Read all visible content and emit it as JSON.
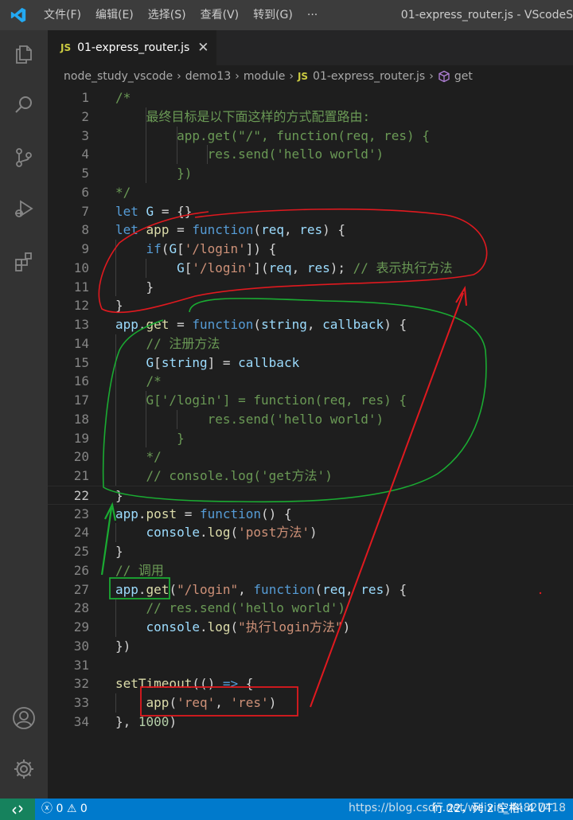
{
  "titlebar": {
    "menu": [
      "文件(F)",
      "编辑(E)",
      "选择(S)",
      "查看(V)",
      "转到(G)",
      "···"
    ],
    "window_title": "01-express_router.js - VScodeS"
  },
  "tab": {
    "js_badge": "JS",
    "label": "01-express_router.js",
    "close": "✕"
  },
  "breadcrumb": {
    "items": [
      "node_study_vscode",
      "demo13",
      "module",
      "01-express_router.js",
      "get"
    ],
    "js_badge": "JS"
  },
  "editor": {
    "current_line": 22,
    "lines": [
      {
        "n": "1",
        "tokens": [
          [
            "cmt",
            "/*"
          ]
        ]
      },
      {
        "n": "2",
        "tokens": [
          [
            "cmt",
            "    最终目标是以下面这样的方式配置路由:"
          ]
        ]
      },
      {
        "n": "3",
        "tokens": [
          [
            "cmt",
            "        app.get(\"/\", function(req, res) {"
          ]
        ]
      },
      {
        "n": "4",
        "tokens": [
          [
            "cmt",
            "            res.send('hello world')"
          ]
        ]
      },
      {
        "n": "5",
        "tokens": [
          [
            "cmt",
            "        })"
          ]
        ]
      },
      {
        "n": "6",
        "tokens": [
          [
            "cmt",
            "*/"
          ]
        ]
      },
      {
        "n": "7",
        "tokens": [
          [
            "kw",
            "let"
          ],
          [
            "pn",
            " "
          ],
          [
            "var",
            "G"
          ],
          [
            "pn",
            " = {}"
          ]
        ]
      },
      {
        "n": "8",
        "tokens": [
          [
            "kw",
            "let"
          ],
          [
            "pn",
            " "
          ],
          [
            "fn",
            "app"
          ],
          [
            "pn",
            " = "
          ],
          [
            "kw",
            "function"
          ],
          [
            "pn",
            "("
          ],
          [
            "var",
            "req"
          ],
          [
            "pn",
            ", "
          ],
          [
            "var",
            "res"
          ],
          [
            "pn",
            ") {"
          ]
        ]
      },
      {
        "n": "9",
        "tokens": [
          [
            "pn",
            "    "
          ],
          [
            "kw",
            "if"
          ],
          [
            "pn",
            "("
          ],
          [
            "var",
            "G"
          ],
          [
            "pn",
            "["
          ],
          [
            "str",
            "'/login'"
          ],
          [
            "pn",
            "]) {"
          ]
        ]
      },
      {
        "n": "10",
        "tokens": [
          [
            "pn",
            "        "
          ],
          [
            "var",
            "G"
          ],
          [
            "pn",
            "["
          ],
          [
            "str",
            "'/login'"
          ],
          [
            "pn",
            "]("
          ],
          [
            "var",
            "req"
          ],
          [
            "pn",
            ", "
          ],
          [
            "var",
            "res"
          ],
          [
            "pn",
            "); "
          ],
          [
            "cmt",
            "// 表示执行方法"
          ]
        ]
      },
      {
        "n": "11",
        "tokens": [
          [
            "pn",
            "    }"
          ]
        ]
      },
      {
        "n": "12",
        "tokens": [
          [
            "pn",
            "}"
          ]
        ]
      },
      {
        "n": "13",
        "tokens": [
          [
            "var",
            "app"
          ],
          [
            "pn",
            "."
          ],
          [
            "fn",
            "get"
          ],
          [
            "pn",
            " = "
          ],
          [
            "kw",
            "function"
          ],
          [
            "pn",
            "("
          ],
          [
            "var",
            "string"
          ],
          [
            "pn",
            ", "
          ],
          [
            "var",
            "callback"
          ],
          [
            "pn",
            ") {"
          ]
        ]
      },
      {
        "n": "14",
        "tokens": [
          [
            "pn",
            "    "
          ],
          [
            "cmt",
            "// 注册方法"
          ]
        ]
      },
      {
        "n": "15",
        "tokens": [
          [
            "pn",
            "    "
          ],
          [
            "var",
            "G"
          ],
          [
            "pn",
            "["
          ],
          [
            "var",
            "string"
          ],
          [
            "pn",
            "] = "
          ],
          [
            "var",
            "callback"
          ]
        ]
      },
      {
        "n": "16",
        "tokens": [
          [
            "pn",
            "    "
          ],
          [
            "cmt",
            "/*"
          ]
        ]
      },
      {
        "n": "17",
        "tokens": [
          [
            "pn",
            "    "
          ],
          [
            "cmt",
            "G['/login'] = function(req, res) {"
          ]
        ]
      },
      {
        "n": "18",
        "tokens": [
          [
            "pn",
            "    "
          ],
          [
            "cmt",
            "        res.send('hello world')"
          ]
        ]
      },
      {
        "n": "19",
        "tokens": [
          [
            "pn",
            "    "
          ],
          [
            "cmt",
            "    }"
          ]
        ]
      },
      {
        "n": "20",
        "tokens": [
          [
            "pn",
            "    "
          ],
          [
            "cmt",
            "*/"
          ]
        ]
      },
      {
        "n": "21",
        "tokens": [
          [
            "pn",
            "    "
          ],
          [
            "cmt",
            "// console.log('get方法')"
          ]
        ]
      },
      {
        "n": "22",
        "tokens": [
          [
            "pn",
            "}"
          ]
        ]
      },
      {
        "n": "23",
        "tokens": [
          [
            "var",
            "app"
          ],
          [
            "pn",
            "."
          ],
          [
            "fn",
            "post"
          ],
          [
            "pn",
            " = "
          ],
          [
            "kw",
            "function"
          ],
          [
            "pn",
            "() {"
          ]
        ]
      },
      {
        "n": "24",
        "tokens": [
          [
            "pn",
            "    "
          ],
          [
            "var",
            "console"
          ],
          [
            "pn",
            "."
          ],
          [
            "fn",
            "log"
          ],
          [
            "pn",
            "("
          ],
          [
            "str",
            "'post方法'"
          ],
          [
            "pn",
            ")"
          ]
        ]
      },
      {
        "n": "25",
        "tokens": [
          [
            "pn",
            "}"
          ]
        ]
      },
      {
        "n": "26",
        "tokens": [
          [
            "cmt",
            "// 调用"
          ]
        ]
      },
      {
        "n": "27",
        "tokens": [
          [
            "var",
            "app"
          ],
          [
            "pn",
            "."
          ],
          [
            "fn",
            "get"
          ],
          [
            "pn",
            "("
          ],
          [
            "str",
            "\"/login\""
          ],
          [
            "pn",
            ", "
          ],
          [
            "kw",
            "function"
          ],
          [
            "pn",
            "("
          ],
          [
            "var",
            "req"
          ],
          [
            "pn",
            ", "
          ],
          [
            "var",
            "res"
          ],
          [
            "pn",
            ") {"
          ]
        ]
      },
      {
        "n": "28",
        "tokens": [
          [
            "pn",
            "    "
          ],
          [
            "cmt",
            "// res.send('hello world')"
          ]
        ]
      },
      {
        "n": "29",
        "tokens": [
          [
            "pn",
            "    "
          ],
          [
            "var",
            "console"
          ],
          [
            "pn",
            "."
          ],
          [
            "fn",
            "log"
          ],
          [
            "pn",
            "("
          ],
          [
            "str",
            "\"执行login方法\""
          ],
          [
            "pn",
            ")"
          ]
        ]
      },
      {
        "n": "30",
        "tokens": [
          [
            "pn",
            "})"
          ]
        ]
      },
      {
        "n": "31",
        "tokens": []
      },
      {
        "n": "32",
        "tokens": [
          [
            "fn",
            "setTimeout"
          ],
          [
            "pn",
            "(() "
          ],
          [
            "kw",
            "=>"
          ],
          [
            "pn",
            " {"
          ]
        ]
      },
      {
        "n": "33",
        "tokens": [
          [
            "pn",
            "    "
          ],
          [
            "fn",
            "app"
          ],
          [
            "pn",
            "("
          ],
          [
            "str",
            "'req'"
          ],
          [
            "pn",
            ", "
          ],
          [
            "str",
            "'res'"
          ],
          [
            "pn",
            ")"
          ]
        ]
      },
      {
        "n": "34",
        "tokens": [
          [
            "pn",
            "}, "
          ],
          [
            "num",
            "1000"
          ],
          [
            "pn",
            ")"
          ]
        ]
      }
    ]
  },
  "statusbar": {
    "remote_icon": "remote-icon",
    "errors": "0",
    "warnings": "0",
    "position": "行 22，列 2   空格: 4   UT",
    "watermark": "https://blog.csdn.net/weixin_44827418"
  },
  "colors": {
    "annotation_red": "#e0191f",
    "annotation_green": "#1aab32",
    "status_bar": "#007acc"
  }
}
